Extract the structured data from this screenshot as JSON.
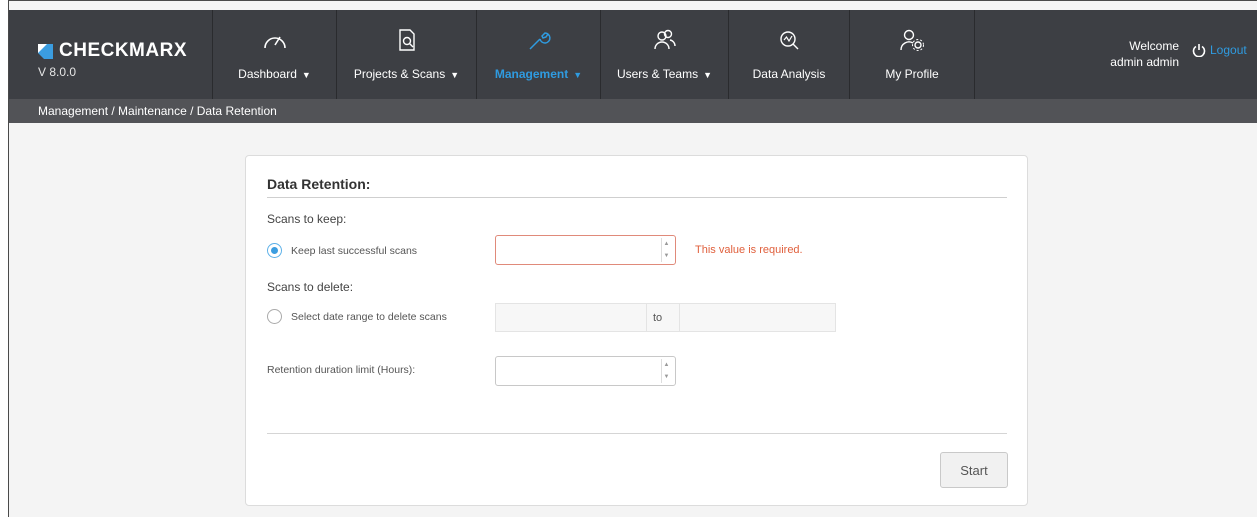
{
  "brand": {
    "name": "CHECKMARX",
    "version": "V 8.0.0"
  },
  "nav": [
    {
      "label": "Dashboard",
      "icon": "gauge-icon",
      "has_caret": true
    },
    {
      "label": "Projects & Scans",
      "icon": "document-search-icon",
      "has_caret": true
    },
    {
      "label": "Management",
      "icon": "wrench-icon",
      "has_caret": true,
      "active": true
    },
    {
      "label": "Users & Teams",
      "icon": "users-icon",
      "has_caret": true
    },
    {
      "label": "Data Analysis",
      "icon": "analysis-icon",
      "has_caret": false
    },
    {
      "label": "My Profile",
      "icon": "user-gear-icon",
      "has_caret": false
    }
  ],
  "header": {
    "welcome": "Welcome",
    "user": "admin admin",
    "logout": "Logout"
  },
  "breadcrumb": "Management / Maintenance / Data Retention",
  "form": {
    "title": "Data Retention:",
    "scans_to_keep_label": "Scans to keep:",
    "keep_last_label": "Keep last successful scans",
    "keep_last_value": "",
    "required_error": "This value is required.",
    "scans_to_delete_label": "Scans to delete:",
    "date_range_label": "Select date range to delete scans",
    "date_from": "",
    "to_label": "to",
    "date_to": "",
    "duration_label": "Retention duration limit (Hours):",
    "duration_value": "",
    "start_button": "Start"
  },
  "colors": {
    "nav_bg": "#3d3f44",
    "accent": "#2f9be0",
    "error": "#e0603d"
  }
}
